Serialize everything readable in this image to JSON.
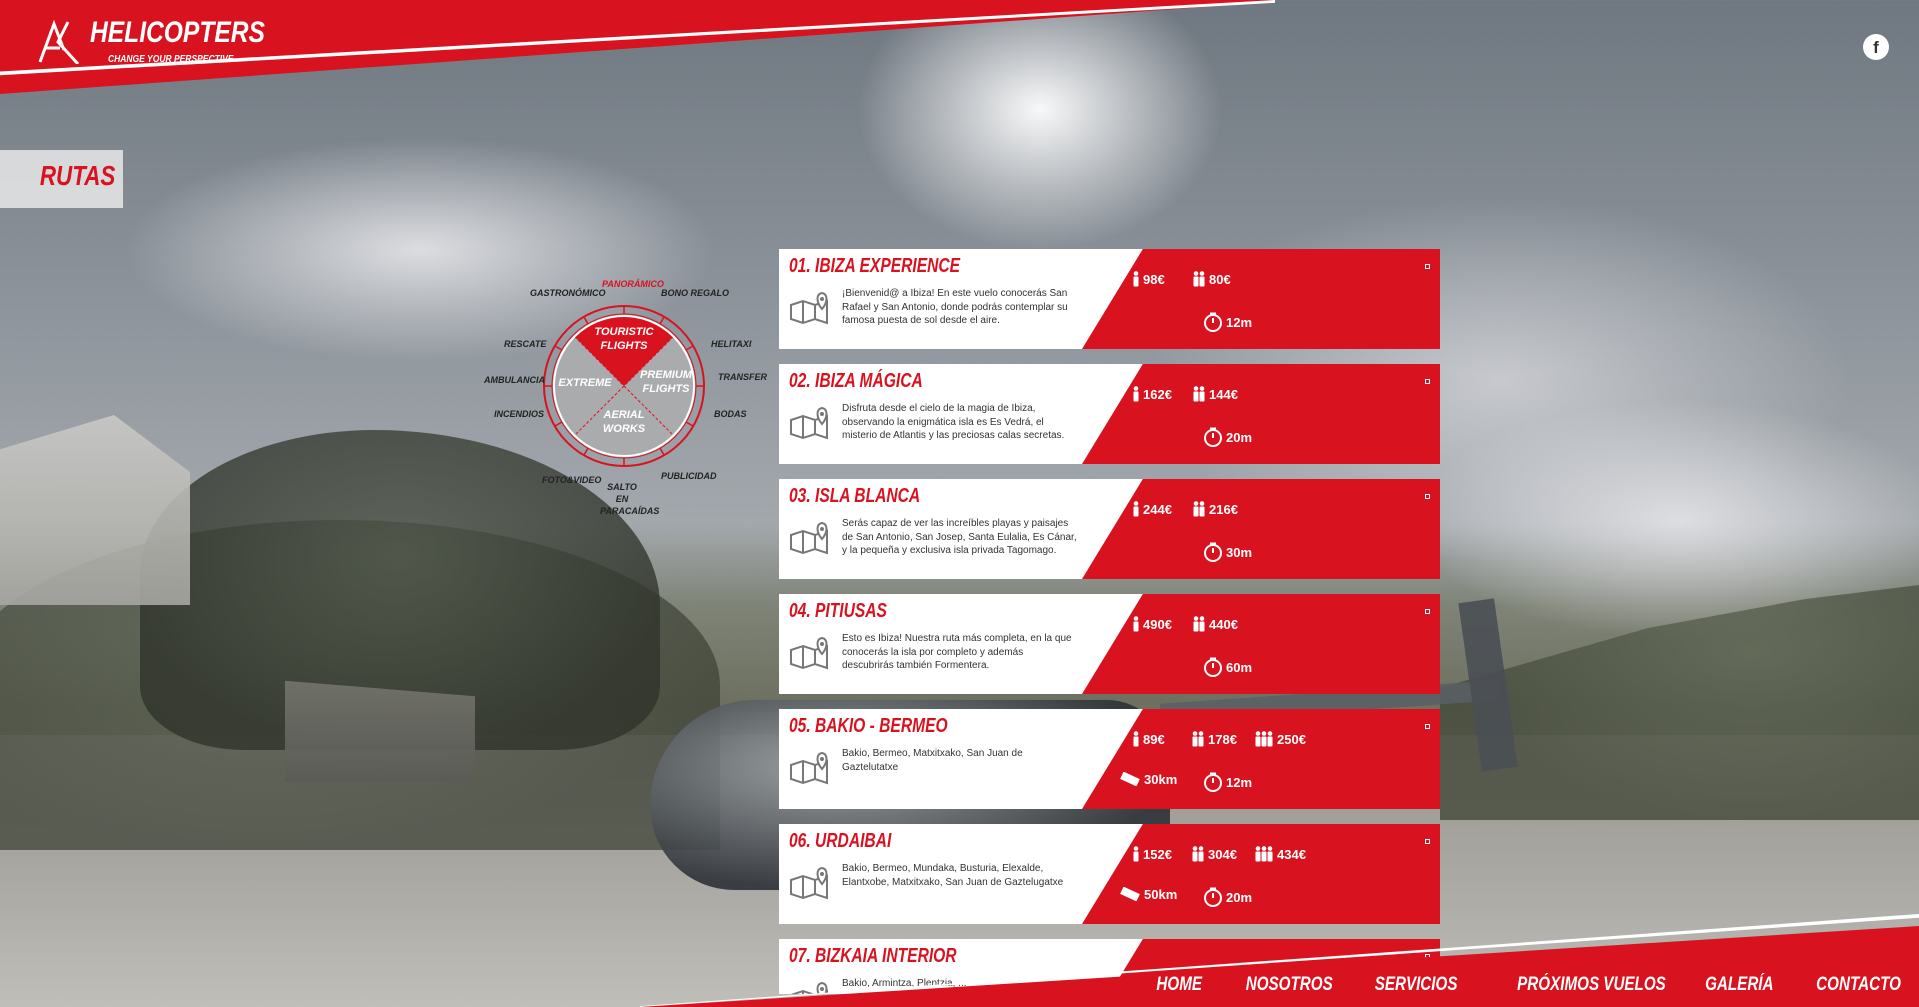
{
  "brand": {
    "mark": "AK",
    "name": "HELICOPTERS",
    "tagline": "CHANGE YOUR PERSPECTIVE"
  },
  "social": {
    "facebook": "f"
  },
  "section": {
    "title": "RUTAS"
  },
  "wheel": {
    "center": {
      "touristic": "TOURISTIC FLIGHTS",
      "premium": "PREMIUM FLIGHTS",
      "extreme": "EXTREME",
      "aerial": "AERIAL WORKS"
    },
    "labels": {
      "gastronomico": "GASTRONÓMICO",
      "panoramico": "PANORÁMICO",
      "bono_regalo": "BONO REGALO",
      "rescate": "RESCATE",
      "helitaxi": "HELITAXI",
      "ambulancia": "AMBULANCIA",
      "transfer": "TRANSFER",
      "incendios": "INCENDIOS",
      "bodas": "BODAS",
      "fotovideo": "FOTO&VIDEO",
      "publicidad": "PUBLICIDAD",
      "salto": "SALTO EN PARACAÍDAS"
    }
  },
  "routes": [
    {
      "title": "01. IBIZA EXPERIENCE",
      "description": "¡Bienvenid@ a Ibiza! En este vuelo conocerás San Rafael y San Antonio, donde podrás contemplar su famosa puesta de sol desde el aire.",
      "price_1": "98€",
      "price_2": "80€",
      "price_3": "",
      "distance": "",
      "duration": "12m"
    },
    {
      "title": "02. IBIZA MÁGICA",
      "description": "Disfruta desde el cielo de la magia de Ibiza, observando la enigmática isla es Es Vedrá, el misterio de Atlantis y las preciosas calas secretas.",
      "price_1": "162€",
      "price_2": "144€",
      "price_3": "",
      "distance": "",
      "duration": "20m"
    },
    {
      "title": "03. ISLA BLANCA",
      "description": "Serás capaz de ver las increíbles playas y paisajes de San Antonio, San Josep, Santa Eulalia, Es Cánar, y la pequeña y exclusiva isla privada Tagomago.",
      "price_1": "244€",
      "price_2": "216€",
      "price_3": "",
      "distance": "",
      "duration": "30m"
    },
    {
      "title": "04. PITIUSAS",
      "description": "Esto es Ibiza! Nuestra ruta más completa, en la que conocerás la isla por completo y además descubrirás también Formentera.",
      "price_1": "490€",
      "price_2": "440€",
      "price_3": "",
      "distance": "",
      "duration": "60m"
    },
    {
      "title": "05. BAKIO - BERMEO",
      "description": "Bakio, Bermeo, Matxitxako, San Juan de Gaztelutatxe",
      "price_1": "89€",
      "price_2": "178€",
      "price_3": "250€",
      "distance": "30km",
      "duration": "12m"
    },
    {
      "title": "06. URDAIBAI",
      "description": "Bakio, Bermeo, Mundaka, Busturia, Elexalde, Elantxobe, Matxitxako, San Juan de Gaztelugatxe",
      "price_1": "152€",
      "price_2": "304€",
      "price_3": "434€",
      "distance": "50km",
      "duration": "20m"
    },
    {
      "title": "07. BIZKAIA INTERIOR",
      "description": "Bakio, Armintza, Plentzia, ...",
      "price_1": "",
      "price_2": "",
      "price_3": "",
      "distance": "",
      "duration": ""
    }
  ],
  "nav": {
    "home": "HOME",
    "nosotros": "NOSOTROS",
    "servicios": "SERVICIOS",
    "proximos": "PRÓXIMOS VUELOS",
    "galeria": "GALERÍA",
    "contacto": "CONTACTO"
  },
  "colors": {
    "brand_red": "#d9121f",
    "white": "#ffffff"
  },
  "icons": [
    "facebook-icon",
    "map-pin-icon",
    "person-icon",
    "two-persons-icon",
    "three-persons-icon",
    "ruler-icon",
    "stopwatch-icon"
  ]
}
